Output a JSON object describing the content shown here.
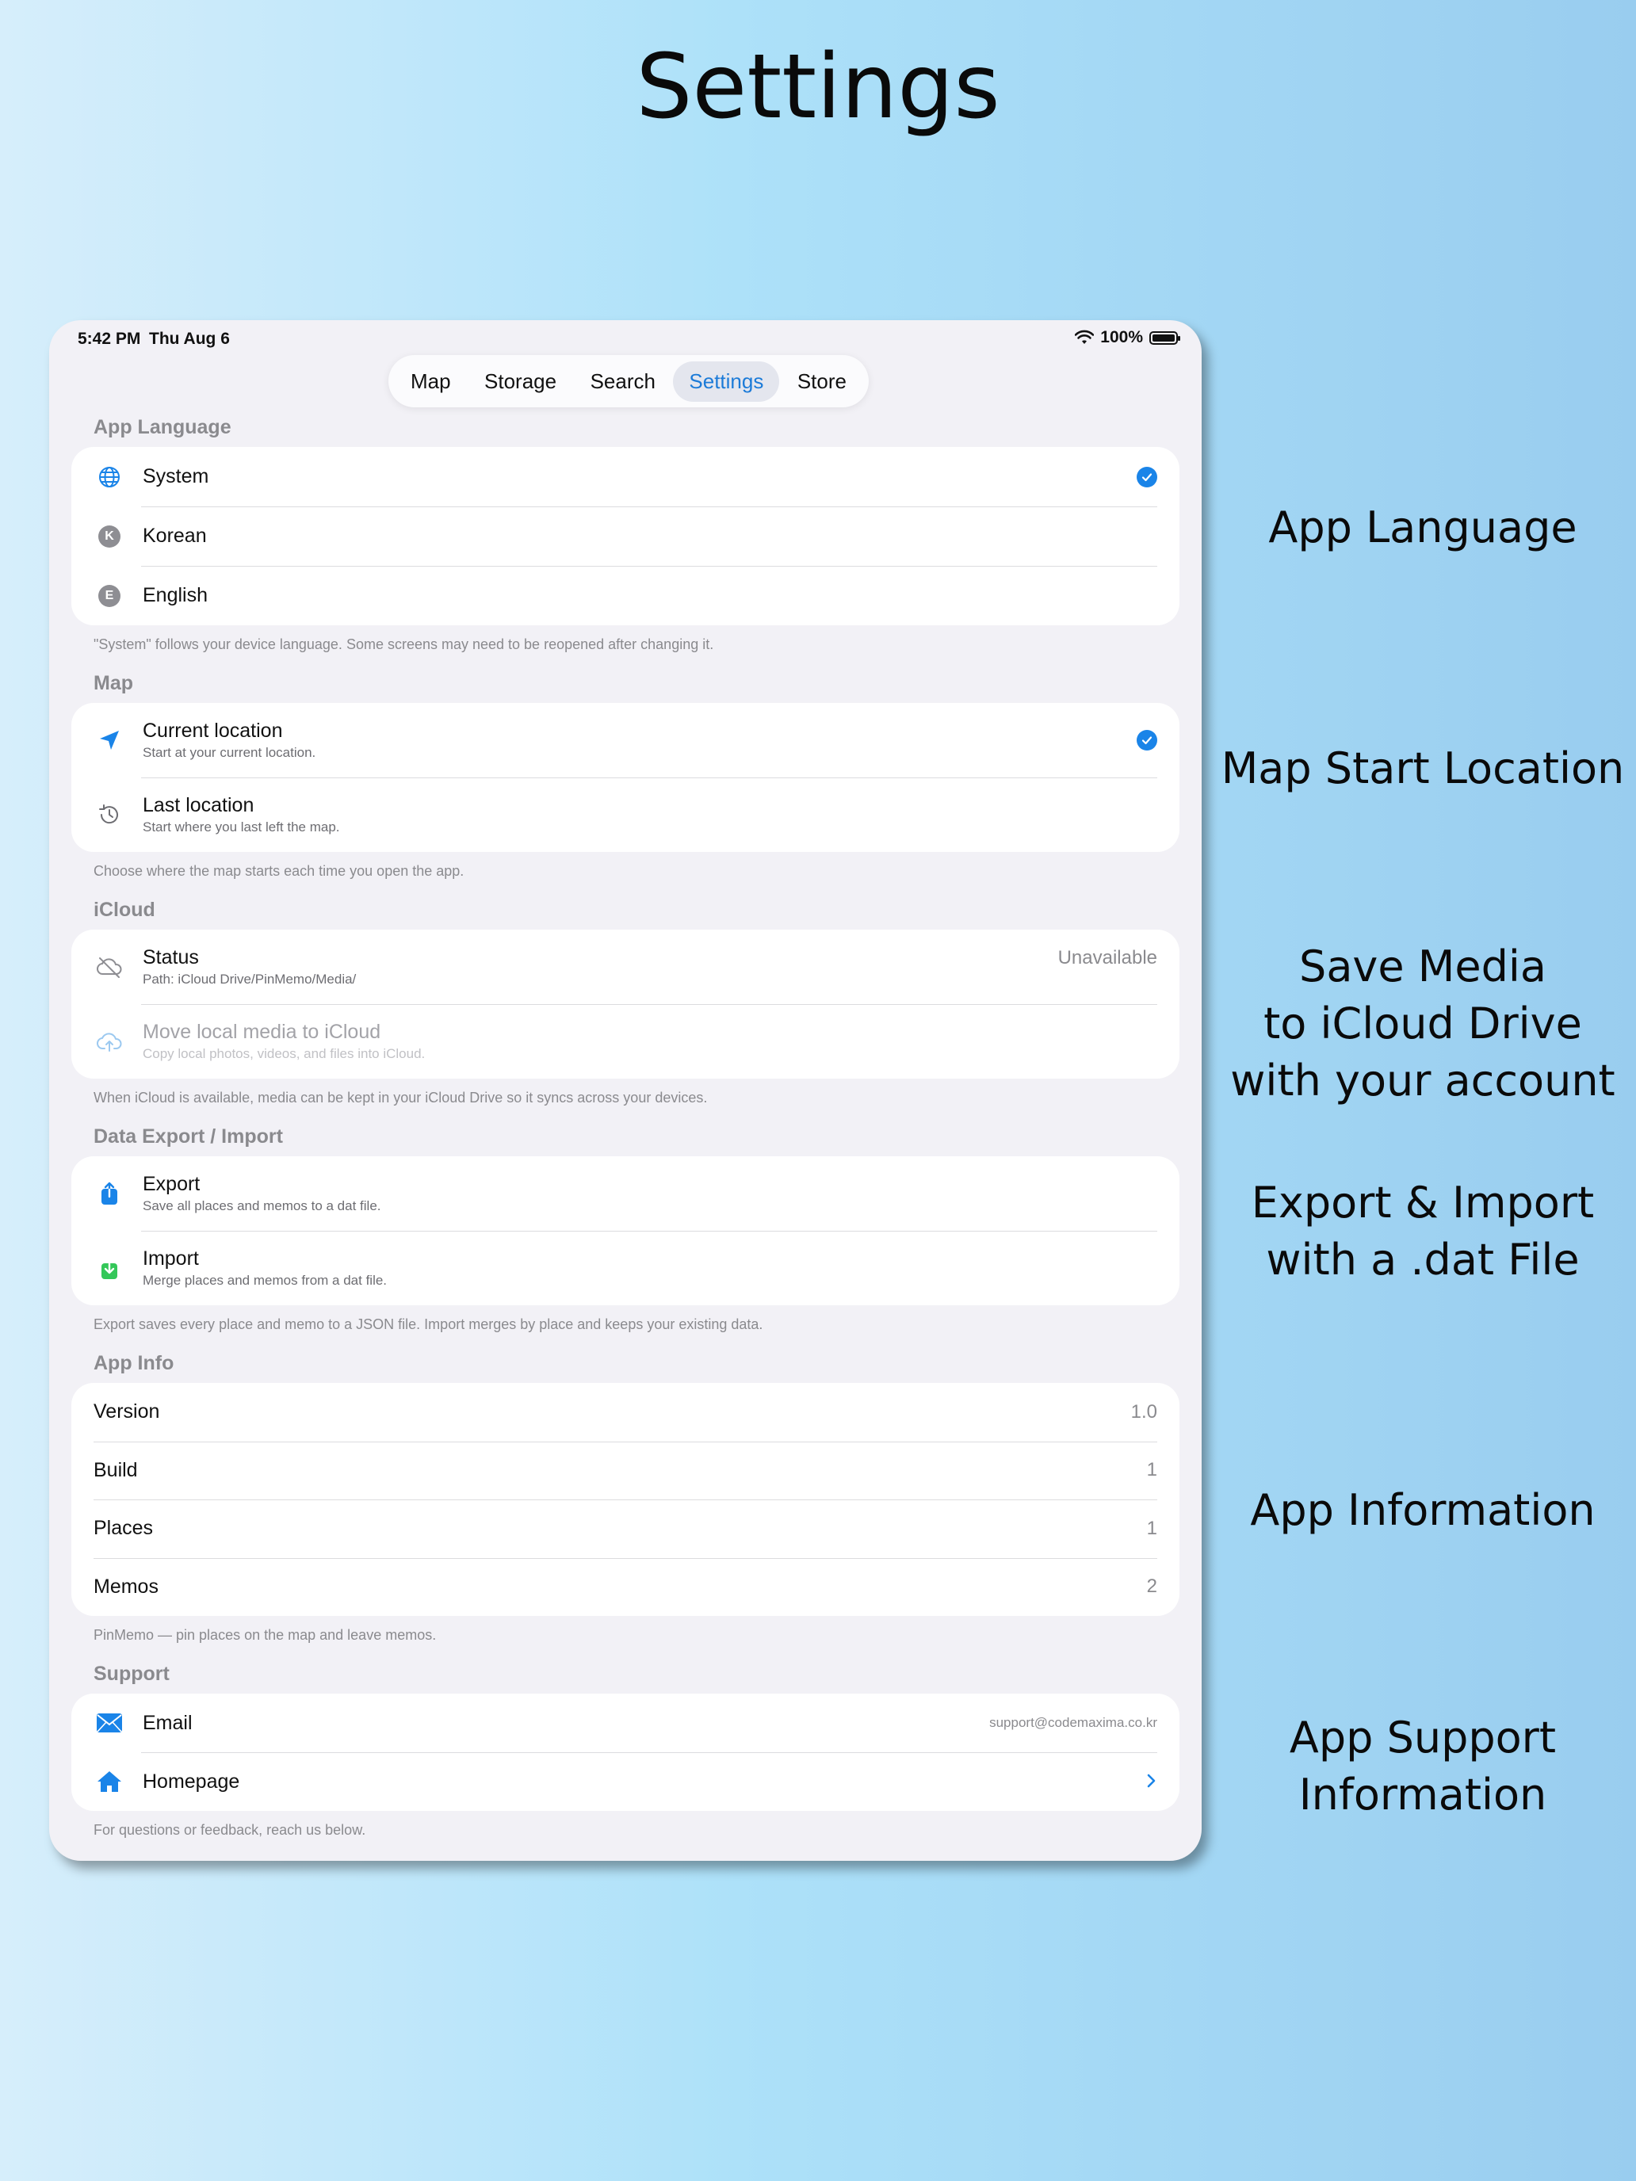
{
  "page_title": "Settings",
  "captions": {
    "app_language": "App Language",
    "map_start": "Map Start Location",
    "save_media": [
      "Save Media",
      "to iCloud  Drive",
      "with your account"
    ],
    "export_import": [
      "Export & Import",
      "with a .dat File"
    ],
    "app_info": "App Information",
    "app_support": [
      "App Support",
      "Information"
    ]
  },
  "status_bar": {
    "time": "5:42 PM",
    "date": "Thu Aug 6",
    "battery": "100%",
    "battery_level": 1.0
  },
  "tabs": [
    {
      "label": "Map"
    },
    {
      "label": "Storage"
    },
    {
      "label": "Search"
    },
    {
      "label": "Settings",
      "active": true
    },
    {
      "label": "Store"
    }
  ],
  "colors": {
    "accent": "#1a84e8",
    "green": "#34c759",
    "secondary": "#8a8a8e"
  },
  "app_language": {
    "header": "App Language",
    "items": [
      {
        "label": "System",
        "icon": "globe-icon",
        "selected": true
      },
      {
        "label": "Korean",
        "icon": "letter-k-icon",
        "badge": "K"
      },
      {
        "label": "English",
        "icon": "letter-e-icon",
        "badge": "E"
      }
    ],
    "footer": "\"System\" follows your device language. Some screens may need to be reopened after changing it."
  },
  "map": {
    "header": "Map",
    "items": [
      {
        "label": "Current location",
        "sub": "Start at your current location.",
        "icon": "location-arrow-icon",
        "selected": true
      },
      {
        "label": "Last location",
        "sub": "Start where you last left the map.",
        "icon": "history-icon"
      }
    ],
    "footer": "Choose where the map starts each time you open the app."
  },
  "icloud": {
    "header": "iCloud",
    "status": {
      "label": "Status",
      "sub": "Path: iCloud Drive/PinMemo/Media/",
      "value": "Unavailable",
      "icon": "cloud-slash-icon"
    },
    "move": {
      "label": "Move local media to iCloud",
      "sub": "Copy local photos, videos, and files into iCloud.",
      "icon": "cloud-upload-icon"
    },
    "footer": "When iCloud is available, media can be kept in your iCloud Drive so it syncs across your devices."
  },
  "data": {
    "header": "Data Export / Import",
    "export": {
      "label": "Export",
      "sub": "Save all places and memos to a dat file.",
      "icon": "share-upload-icon"
    },
    "import": {
      "label": "Import",
      "sub": "Merge places and memos from a dat file.",
      "icon": "tray-download-icon"
    },
    "footer": "Export saves every place and memo to a JSON file. Import merges by place and keeps your existing data."
  },
  "app_info": {
    "header": "App Info",
    "rows": [
      {
        "label": "Version",
        "value": "1.0"
      },
      {
        "label": "Build",
        "value": "1"
      },
      {
        "label": "Places",
        "value": "1"
      },
      {
        "label": "Memos",
        "value": "2"
      }
    ],
    "footer": "PinMemo — pin places on the map and leave memos."
  },
  "support": {
    "header": "Support",
    "email": {
      "label": "Email",
      "value": "support@codemaxima.co.kr",
      "icon": "envelope-icon"
    },
    "homepage": {
      "label": "Homepage",
      "icon": "house-icon"
    },
    "footer": "For questions or feedback, reach us below."
  }
}
